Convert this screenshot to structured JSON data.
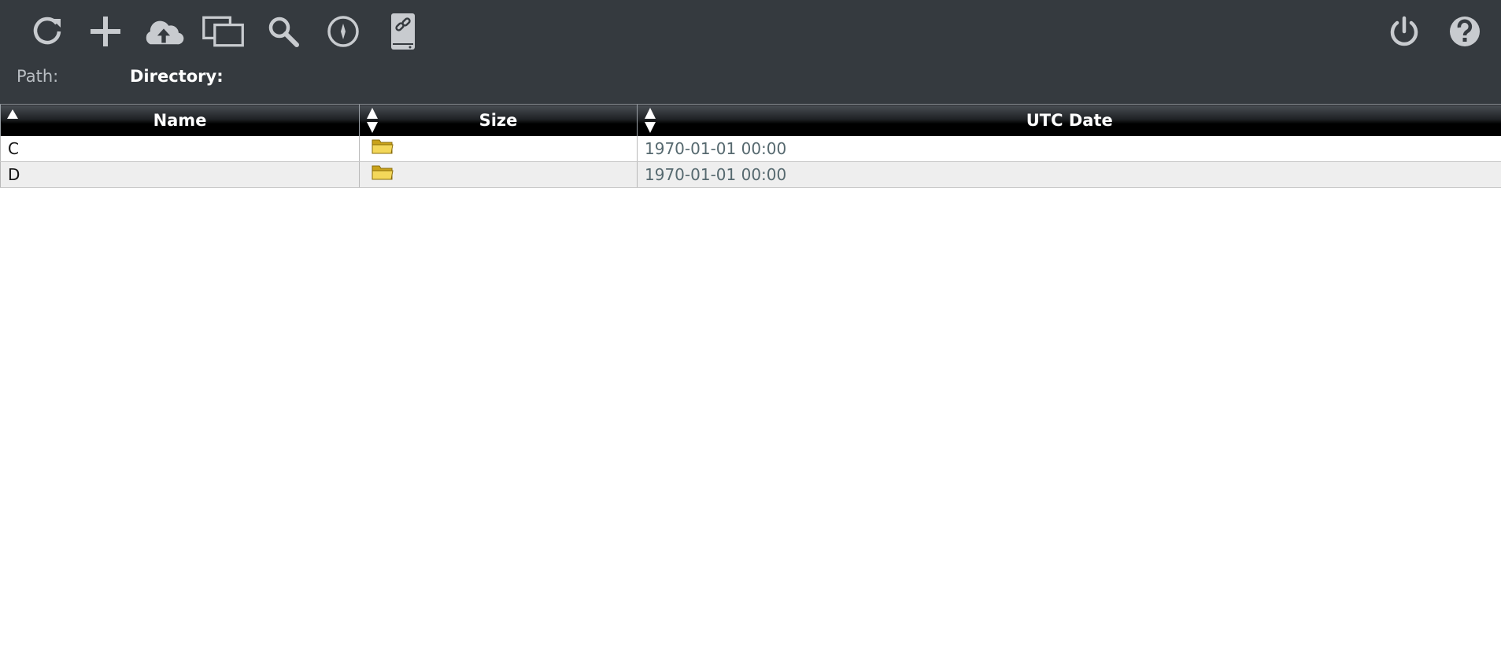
{
  "toolbar": {
    "left_tools": [
      "refresh-icon",
      "add-icon",
      "cloud-upload-icon",
      "windows-icon",
      "search-icon",
      "compass-icon",
      "linked-drive-icon"
    ],
    "right_tools": [
      "power-icon",
      "help-icon"
    ],
    "icon_color": "#c8cbcf",
    "background": "#353a3f"
  },
  "path": {
    "path_label": "Path:",
    "directory_label": "Directory:"
  },
  "table": {
    "columns": {
      "name": "Name",
      "size": "Size",
      "date": "UTC Date"
    },
    "rows": [
      {
        "name": "C",
        "type": "folder-icon",
        "date": "1970-01-01 00:00"
      },
      {
        "name": "D",
        "type": "folder-icon",
        "date": "1970-01-01 00:00"
      }
    ]
  }
}
